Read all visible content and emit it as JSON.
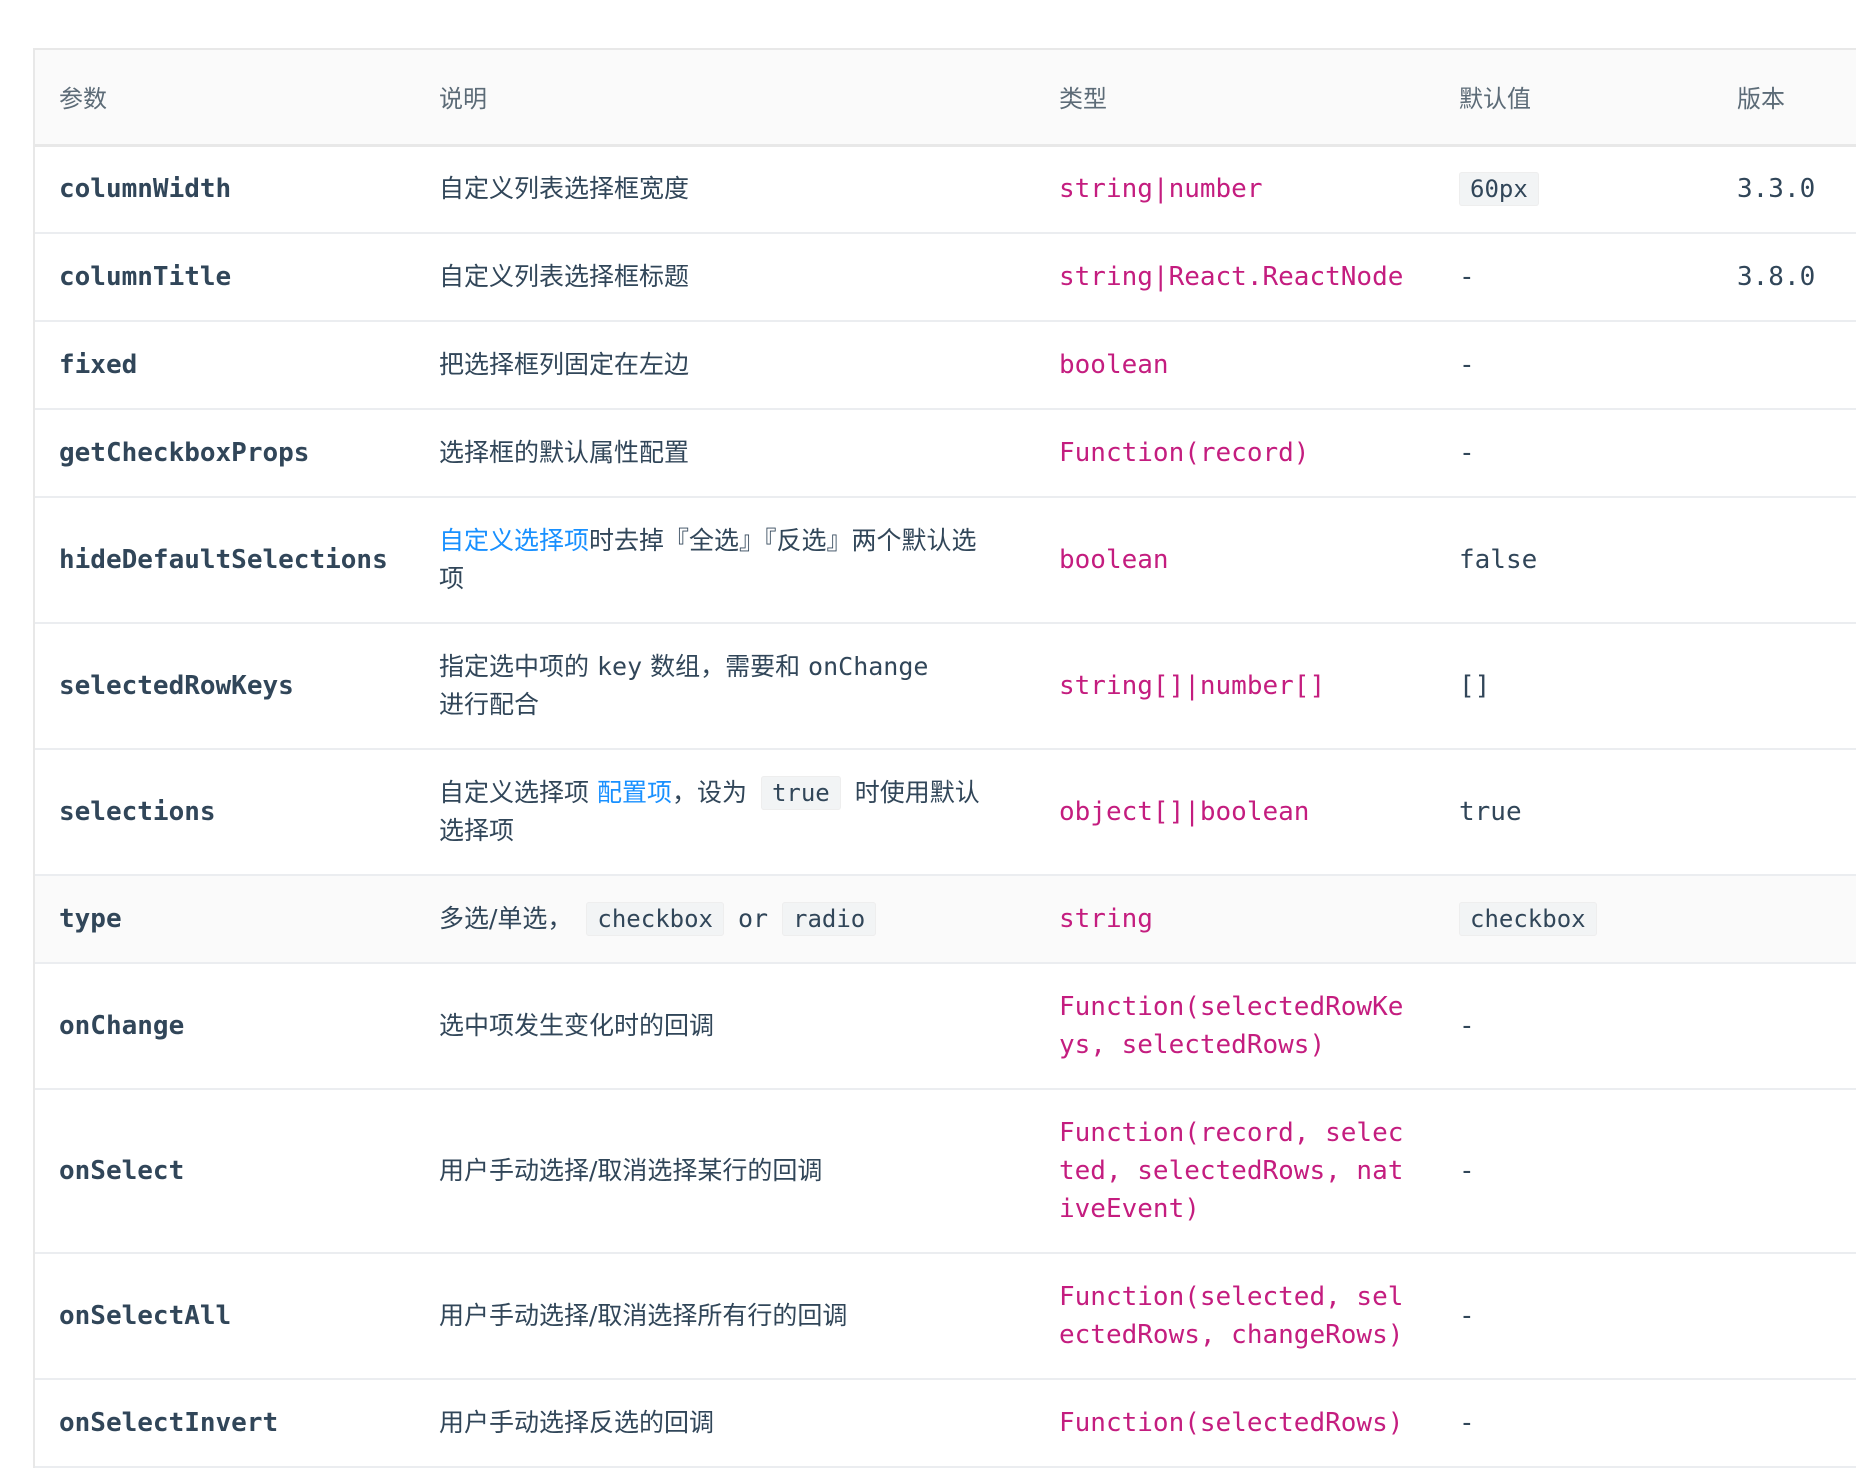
{
  "colors": {
    "type_text": "#c41d7f",
    "link": "#1890ff",
    "body_text": "#314659",
    "header_bg": "#fafafa"
  },
  "header": {
    "param": "参数",
    "description": "说明",
    "type": "类型",
    "default": "默认值",
    "version": "版本"
  },
  "rows": [
    {
      "param": "columnWidth",
      "description": "自定义列表选择框宽度",
      "type": "string|number",
      "default": "60px",
      "version": "3.3.0"
    },
    {
      "param": "columnTitle",
      "description": "自定义列表选择框标题",
      "type": "string|React.ReactNode",
      "default": "-",
      "version": "3.8.0"
    },
    {
      "param": "fixed",
      "description": "把选择框列固定在左边",
      "type": "boolean",
      "default": "-",
      "version": ""
    },
    {
      "param": "getCheckboxProps",
      "description": "选择框的默认属性配置",
      "type": "Function(record)",
      "default": "-",
      "version": ""
    },
    {
      "param": "hideDefaultSelections",
      "description_link": "自定义选择项",
      "description": "时去掉『全选』『反选』两个默认选项",
      "type": "boolean",
      "default": "false",
      "version": ""
    },
    {
      "param": "selectedRowKeys",
      "description_a": "指定选中项的",
      "description_key": "key",
      "description_b": "数组，需要和",
      "description_onchange": "onChange",
      "description_c": "进行配合",
      "type": "string[]|number[]",
      "default": "[]",
      "version": ""
    },
    {
      "param": "selections",
      "description_a": "自定义选择项",
      "description_link": "配置项",
      "description_b": "，设为",
      "description_code": "true",
      "description_c": "时使用默认选择项",
      "type": "object[]|boolean",
      "default": "true",
      "version": ""
    },
    {
      "param": "type",
      "description_a": "多选/单选，",
      "description_code1": "checkbox",
      "description_or": "or",
      "description_code2": "radio",
      "type": "string",
      "default": "checkbox",
      "version": ""
    },
    {
      "param": "onChange",
      "description": "选中项发生变化时的回调",
      "type": "Function(selectedRowKeys, selectedRows)",
      "default": "-",
      "version": ""
    },
    {
      "param": "onSelect",
      "description": "用户手动选择/取消选择某行的回调",
      "type": "Function(record, selected, selectedRows, nativeEvent)",
      "default": "-",
      "version": ""
    },
    {
      "param": "onSelectAll",
      "description": "用户手动选择/取消选择所有行的回调",
      "type": "Function(selected, selectedRows, changeRows)",
      "default": "-",
      "version": ""
    },
    {
      "param": "onSelectInvert",
      "description": "用户手动选择反选的回调",
      "type": "Function(selectedRows)",
      "default": "-",
      "version": ""
    }
  ]
}
